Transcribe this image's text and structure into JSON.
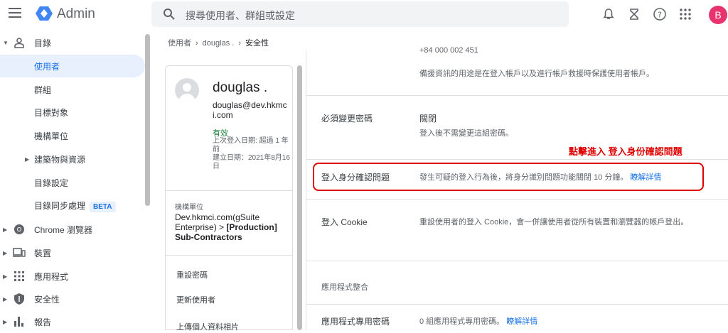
{
  "topbar": {
    "app_title": "Admin",
    "search_placeholder": "搜尋使用者、群組或設定",
    "avatar_letter": "B",
    "avatar_color": "#e8336f"
  },
  "sidebar": {
    "items": [
      {
        "label": "目錄",
        "icon": "person-icon"
      },
      {
        "label": "使用者"
      },
      {
        "label": "群組"
      },
      {
        "label": "目標對象"
      },
      {
        "label": "機構單位"
      },
      {
        "label": "建築物與資源"
      },
      {
        "label": "目錄設定"
      },
      {
        "label": "目錄同步處理",
        "badge": "BETA"
      },
      {
        "label": "Chrome 瀏覽器",
        "icon": "chrome-icon"
      },
      {
        "label": "裝置",
        "icon": "devices-icon"
      },
      {
        "label": "應用程式",
        "icon": "apps-icon"
      },
      {
        "label": "安全性",
        "icon": "shield-icon"
      },
      {
        "label": "報告",
        "icon": "bar-chart-icon"
      }
    ]
  },
  "breadcrumb": {
    "items": [
      "使用者",
      "douglas .",
      "安全性"
    ]
  },
  "user_card": {
    "name": "douglas .",
    "email": "douglas@dev.hkmci.com",
    "status": "有效",
    "last_login": "上次登入日期: 超過 1 年前",
    "created": "建立日期：2021年8月16日",
    "org_label": "機構單位",
    "org_path": "Dev.hkmci.com(gSuite Enterprise) > ",
    "org_bold": "[Production] Sub-Contractors",
    "actions": [
      "重設密碼",
      "更新使用者",
      "上傳個人資料相片"
    ]
  },
  "panel": {
    "phone_partial": "+84 000 002 451",
    "recovery_desc": "備援資訊的用途是在登入帳戶以及進行帳戶救援時保護使用者帳戶。",
    "change_pwd": {
      "label": "必須變更密碼",
      "value": "關閉",
      "desc": "登入後不需變更這組密碼。"
    },
    "annotation": "點擊進入 登入身份確認問題",
    "login_challenge": {
      "label": "登入身分確認問題",
      "desc": "發生可疑的登入行為後，將身分識別問題功能關閉 10 分鐘。",
      "link": "瞭解詳情"
    },
    "cookie": {
      "label": "登入 Cookie",
      "desc": "重設使用者的登入 Cookie，會一併讓使用者從所有裝置和瀏覽器的帳戶登出。"
    },
    "app_integration": "應用程式整合",
    "app_pwd": {
      "label": "應用程式專用密碼",
      "desc": "0 組應用程式專用密碼。",
      "link": "瞭解詳情"
    }
  }
}
